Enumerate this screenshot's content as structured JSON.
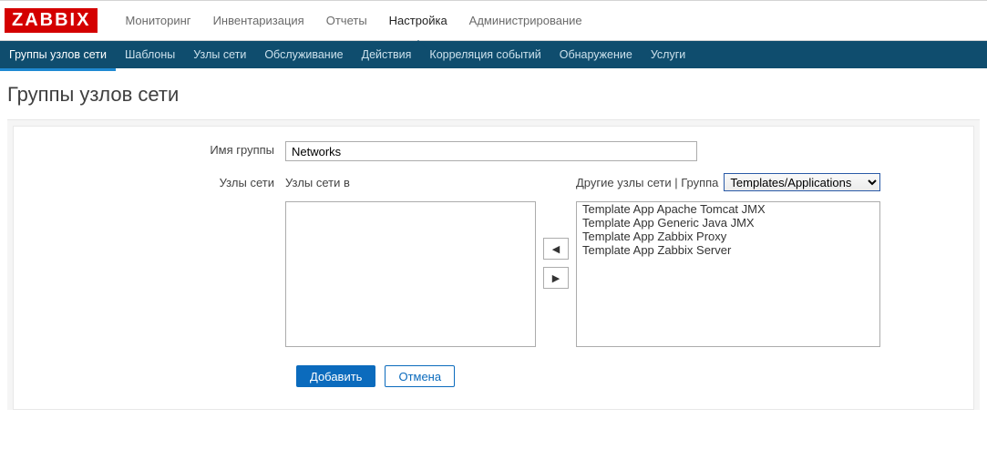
{
  "logo_text": "ZABBIX",
  "topmenu": [
    {
      "label": "Мониторинг"
    },
    {
      "label": "Инвентаризация"
    },
    {
      "label": "Отчеты"
    },
    {
      "label": "Настройка",
      "active": true
    },
    {
      "label": "Администрирование"
    }
  ],
  "submenu": [
    {
      "label": "Группы узлов сети",
      "active": true
    },
    {
      "label": "Шаблоны"
    },
    {
      "label": "Узлы сети"
    },
    {
      "label": "Обслуживание"
    },
    {
      "label": "Действия"
    },
    {
      "label": "Корреляция событий"
    },
    {
      "label": "Обнаружение"
    },
    {
      "label": "Услуги"
    }
  ],
  "page_title": "Группы узлов сети",
  "form": {
    "group_name_label": "Имя группы",
    "group_name_value": "Networks",
    "nodes_label": "Узлы сети",
    "left_header": "Узлы сети в",
    "right_header_prefix": "Другие узлы сети | Группа",
    "group_select_value": "Templates/Applications",
    "right_items": [
      "Template App Apache Tomcat JMX",
      "Template App Generic Java JMX",
      "Template App Zabbix Proxy",
      "Template App Zabbix Server"
    ]
  },
  "buttons": {
    "add": "Добавить",
    "cancel": "Отмена"
  },
  "arrows": {
    "left": "◀",
    "right": "▶"
  }
}
